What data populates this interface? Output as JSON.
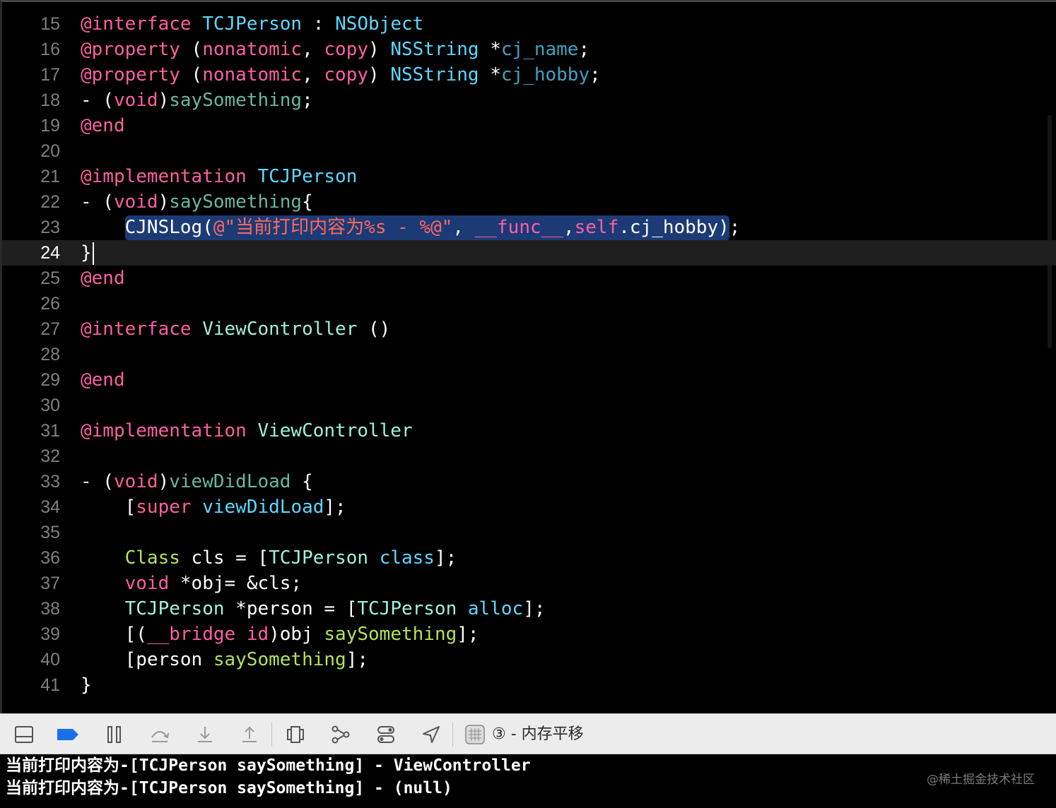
{
  "colors": {
    "keyword": "#fc5fa3",
    "type": "#5dd8ff",
    "project_type": "#9ef1dd",
    "project_func": "#67b7a4",
    "class_green": "#41a1c0",
    "string": "#fc6a5d",
    "text": "#ffffff",
    "func_blue": "#3ca5e6",
    "method_green": "#b1e35c",
    "dim_blue": "#5dd8ff"
  },
  "editor": {
    "lines": [
      {
        "n": "15",
        "tokens": [
          {
            "t": "@interface",
            "c": "#fc5fa3"
          },
          {
            "t": " ",
            "c": "#fff"
          },
          {
            "t": "TCJPerson",
            "c": "#5dd8ff"
          },
          {
            "t": " : ",
            "c": "#fff"
          },
          {
            "t": "NSObject",
            "c": "#5dd8ff"
          }
        ]
      },
      {
        "n": "16",
        "tokens": [
          {
            "t": "@property",
            "c": "#fc5fa3"
          },
          {
            "t": " (",
            "c": "#fff"
          },
          {
            "t": "nonatomic",
            "c": "#fc5fa3"
          },
          {
            "t": ", ",
            "c": "#fff"
          },
          {
            "t": "copy",
            "c": "#fc5fa3"
          },
          {
            "t": ") ",
            "c": "#fff"
          },
          {
            "t": "NSString",
            "c": "#5dd8ff"
          },
          {
            "t": " *",
            "c": "#fff"
          },
          {
            "t": "cj_name",
            "c": "#41a1c0"
          },
          {
            "t": ";",
            "c": "#fff"
          }
        ]
      },
      {
        "n": "17",
        "tokens": [
          {
            "t": "@property",
            "c": "#fc5fa3"
          },
          {
            "t": " (",
            "c": "#fff"
          },
          {
            "t": "nonatomic",
            "c": "#fc5fa3"
          },
          {
            "t": ", ",
            "c": "#fff"
          },
          {
            "t": "copy",
            "c": "#fc5fa3"
          },
          {
            "t": ") ",
            "c": "#fff"
          },
          {
            "t": "NSString",
            "c": "#5dd8ff"
          },
          {
            "t": " *",
            "c": "#fff"
          },
          {
            "t": "cj_hobby",
            "c": "#41a1c0"
          },
          {
            "t": ";",
            "c": "#fff"
          }
        ]
      },
      {
        "n": "18",
        "tokens": [
          {
            "t": "- (",
            "c": "#fff"
          },
          {
            "t": "void",
            "c": "#fc5fa3"
          },
          {
            "t": ")",
            "c": "#fff"
          },
          {
            "t": "saySomething",
            "c": "#67b7a4"
          },
          {
            "t": ";",
            "c": "#fff"
          }
        ]
      },
      {
        "n": "19",
        "tokens": [
          {
            "t": "@end",
            "c": "#fc5fa3"
          }
        ]
      },
      {
        "n": "20",
        "tokens": []
      },
      {
        "n": "21",
        "tokens": [
          {
            "t": "@implementation",
            "c": "#fc5fa3"
          },
          {
            "t": " ",
            "c": "#fff"
          },
          {
            "t": "TCJPerson",
            "c": "#5dd8ff"
          }
        ]
      },
      {
        "n": "22",
        "tokens": [
          {
            "t": "- (",
            "c": "#fff"
          },
          {
            "t": "void",
            "c": "#fc5fa3"
          },
          {
            "t": ")",
            "c": "#fff"
          },
          {
            "t": "saySomething",
            "c": "#67b7a4"
          },
          {
            "t": "{",
            "c": "#fff"
          }
        ]
      },
      {
        "n": "23",
        "highlight": true,
        "tokens": [
          {
            "t": "    ",
            "c": "#fff",
            "plain": true
          },
          {
            "t": "CJNSLog(",
            "c": "#fff"
          },
          {
            "t": "@\"当前打印内容为%s - %@\"",
            "c": "#fc6a5d"
          },
          {
            "t": ", ",
            "c": "#fff"
          },
          {
            "t": "__func__",
            "c": "#fc5fa3"
          },
          {
            "t": ",",
            "c": "#fff"
          },
          {
            "t": "self",
            "c": "#fc5fa3"
          },
          {
            "t": ".cj_hobby",
            "c": "#fff"
          },
          {
            "t": ")",
            "c": "#fff"
          },
          {
            "t": ";",
            "c": "#fff",
            "plain": true
          }
        ]
      },
      {
        "n": "24",
        "current": true,
        "caret": true,
        "tokens": [
          {
            "t": "}",
            "c": "#fff"
          }
        ]
      },
      {
        "n": "25",
        "tokens": [
          {
            "t": "@end",
            "c": "#fc5fa3"
          }
        ]
      },
      {
        "n": "26",
        "tokens": []
      },
      {
        "n": "27",
        "tokens": [
          {
            "t": "@interface",
            "c": "#fc5fa3"
          },
          {
            "t": " ",
            "c": "#fff"
          },
          {
            "t": "ViewController",
            "c": "#9ef1dd"
          },
          {
            "t": " ()",
            "c": "#fff"
          }
        ]
      },
      {
        "n": "28",
        "tokens": []
      },
      {
        "n": "29",
        "tokens": [
          {
            "t": "@end",
            "c": "#fc5fa3"
          }
        ]
      },
      {
        "n": "30",
        "tokens": []
      },
      {
        "n": "31",
        "tokens": [
          {
            "t": "@implementation",
            "c": "#fc5fa3"
          },
          {
            "t": " ",
            "c": "#fff"
          },
          {
            "t": "ViewController",
            "c": "#9ef1dd"
          }
        ]
      },
      {
        "n": "32",
        "tokens": []
      },
      {
        "n": "33",
        "tokens": [
          {
            "t": "- (",
            "c": "#fff"
          },
          {
            "t": "void",
            "c": "#fc5fa3"
          },
          {
            "t": ")",
            "c": "#fff"
          },
          {
            "t": "viewDidLoad",
            "c": "#67b7a4"
          },
          {
            "t": " {",
            "c": "#fff"
          }
        ]
      },
      {
        "n": "34",
        "tokens": [
          {
            "t": "    [",
            "c": "#fff"
          },
          {
            "t": "super",
            "c": "#fc5fa3"
          },
          {
            "t": " ",
            "c": "#fff"
          },
          {
            "t": "viewDidLoad",
            "c": "#5dd8ff"
          },
          {
            "t": "];",
            "c": "#fff"
          }
        ]
      },
      {
        "n": "35",
        "tokens": []
      },
      {
        "n": "36",
        "tokens": [
          {
            "t": "    ",
            "c": "#fff"
          },
          {
            "t": "Class",
            "c": "#b1e35c"
          },
          {
            "t": " cls = [",
            "c": "#fff"
          },
          {
            "t": "TCJPerson",
            "c": "#9ef1dd"
          },
          {
            "t": " ",
            "c": "#fff"
          },
          {
            "t": "class",
            "c": "#5dd8ff"
          },
          {
            "t": "];",
            "c": "#fff"
          }
        ]
      },
      {
        "n": "37",
        "tokens": [
          {
            "t": "    ",
            "c": "#fff"
          },
          {
            "t": "void",
            "c": "#fc5fa3"
          },
          {
            "t": " *obj= &cls;",
            "c": "#fff"
          }
        ]
      },
      {
        "n": "38",
        "tokens": [
          {
            "t": "    ",
            "c": "#fff"
          },
          {
            "t": "TCJPerson",
            "c": "#9ef1dd"
          },
          {
            "t": " *person = [",
            "c": "#fff"
          },
          {
            "t": "TCJPerson",
            "c": "#9ef1dd"
          },
          {
            "t": " ",
            "c": "#fff"
          },
          {
            "t": "alloc",
            "c": "#5dd8ff"
          },
          {
            "t": "];",
            "c": "#fff"
          }
        ]
      },
      {
        "n": "39",
        "tokens": [
          {
            "t": "    [(",
            "c": "#fff"
          },
          {
            "t": "__bridge",
            "c": "#fc5fa3"
          },
          {
            "t": " ",
            "c": "#fff"
          },
          {
            "t": "id",
            "c": "#fc5fa3"
          },
          {
            "t": ")obj ",
            "c": "#fff"
          },
          {
            "t": "saySomething",
            "c": "#b1e35c"
          },
          {
            "t": "];",
            "c": "#fff"
          }
        ]
      },
      {
        "n": "40",
        "tokens": [
          {
            "t": "    [person ",
            "c": "#fff"
          },
          {
            "t": "saySomething",
            "c": "#b1e35c"
          },
          {
            "t": "];",
            "c": "#fff"
          }
        ]
      },
      {
        "n": "41",
        "tokens": [
          {
            "t": "}",
            "c": "#fff"
          }
        ]
      }
    ]
  },
  "toolbar": {
    "thread_label": "③ - 内存平移",
    "buttons": [
      {
        "name": "hide-debug-area-icon"
      },
      {
        "name": "breakpoints-toggle-icon"
      },
      {
        "name": "pause-icon"
      },
      {
        "name": "step-over-icon"
      },
      {
        "name": "step-into-icon"
      },
      {
        "name": "step-out-icon"
      },
      {
        "name": "view-hierarchy-icon"
      },
      {
        "name": "memory-graph-icon"
      },
      {
        "name": "environment-overrides-icon"
      },
      {
        "name": "simulate-location-icon"
      }
    ]
  },
  "console": {
    "lines": [
      "当前打印内容为-[TCJPerson saySomething] - ViewController",
      "当前打印内容为-[TCJPerson saySomething] - (null)"
    ]
  },
  "watermark": "@稀土掘金技术社区"
}
